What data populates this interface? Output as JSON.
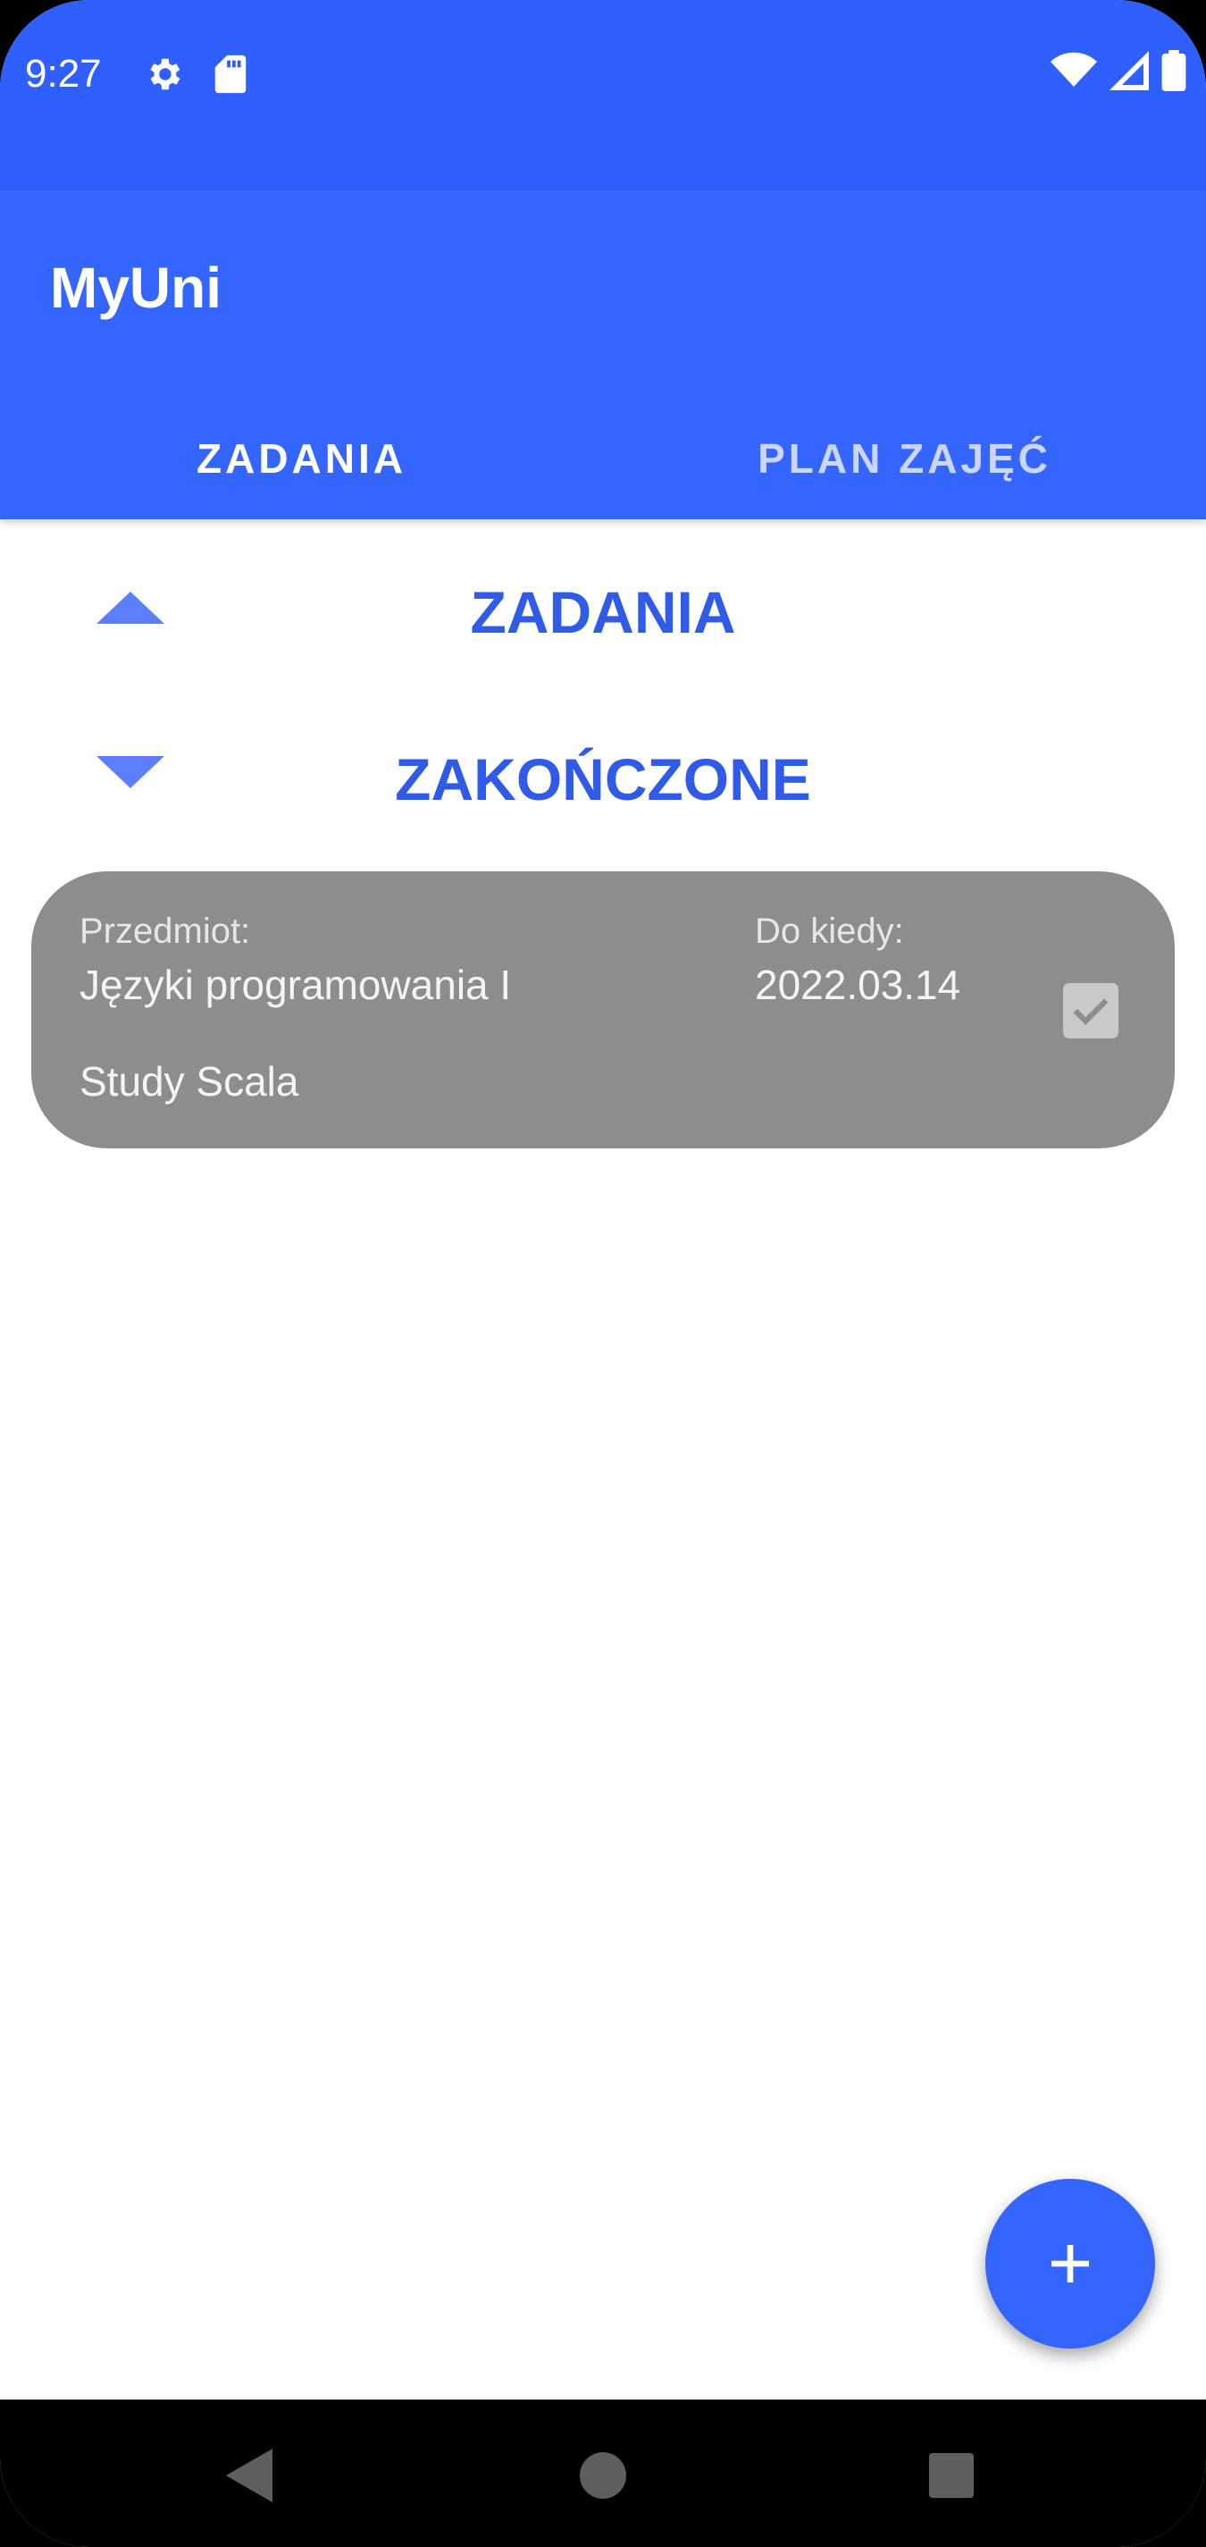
{
  "status_bar": {
    "time": "9:27",
    "icons": [
      "settings-icon",
      "sd-card-icon",
      "wifi-icon",
      "signal-icon",
      "battery-icon"
    ],
    "color": "#2f5fff"
  },
  "app_bar": {
    "title": "MyUni",
    "color": "#3466ff",
    "tabs": [
      {
        "label": "ZADANIA",
        "selected": true
      },
      {
        "label": "PLAN ZAJĘĆ",
        "selected": false
      }
    ]
  },
  "sections": [
    {
      "title": "ZADANIA",
      "arrow": "chevron-up-icon"
    },
    {
      "title": "ZAKOŃCZONE",
      "arrow": "chevron-down-icon"
    }
  ],
  "tasks": [
    {
      "subject_label": "Przedmiot:",
      "subject": "Języki programowania I",
      "due_label": "Do kiedy:",
      "due": "2022.03.14",
      "description": "Study Scala",
      "done": true
    }
  ],
  "fab": {
    "icon": "plus-icon"
  },
  "nav_bar": {
    "buttons": [
      "back-icon",
      "home-icon",
      "recents-icon"
    ]
  }
}
